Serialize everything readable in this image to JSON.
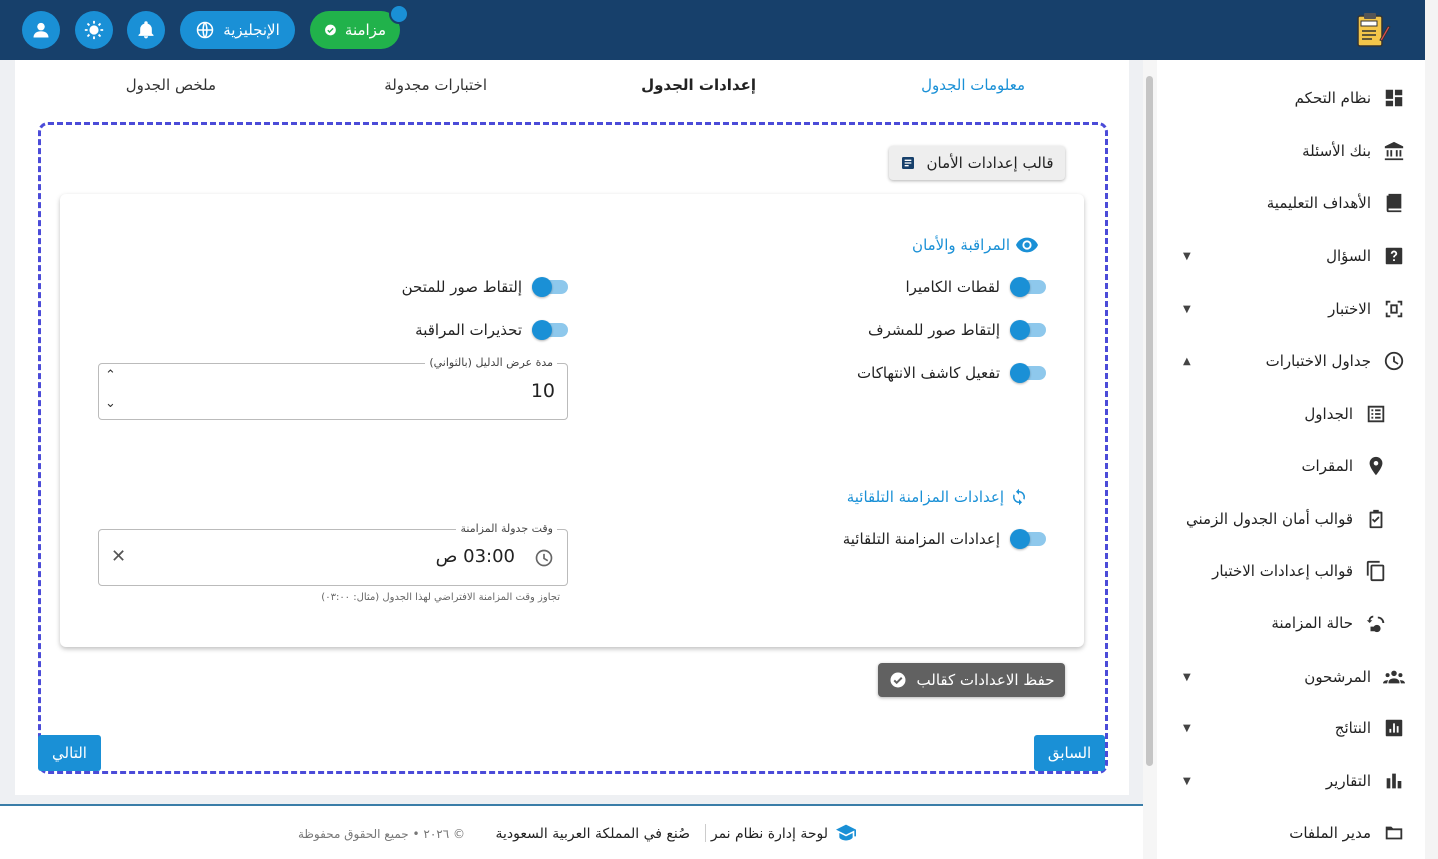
{
  "topbar": {
    "sync_label": "مزامنة",
    "language_label": "الإنجليزية"
  },
  "sidebar": {
    "items": [
      {
        "label": "نظام التحكم",
        "icon": "dashboard-icon"
      },
      {
        "label": "بنك الأسئلة",
        "icon": "bank-icon"
      },
      {
        "label": "الأهداف التعليمية",
        "icon": "book-question-icon"
      },
      {
        "label": "السؤال",
        "icon": "help-box-icon"
      },
      {
        "label": "الاختبار",
        "icon": "exam-frame-icon"
      },
      {
        "label": "جداول الاختبارات",
        "icon": "clock-icon"
      },
      {
        "label": "الجداول",
        "icon": "list-icon"
      },
      {
        "label": "المقرات",
        "icon": "location-pin-icon"
      },
      {
        "label": "قوالب أمان الجدول الزمني",
        "icon": "clipboard-check-icon"
      },
      {
        "label": "قوالب إعدادات الاختبار",
        "icon": "copy-icon"
      },
      {
        "label": "حالة المزامنة",
        "icon": "sync-status-icon"
      },
      {
        "label": "المرشحون",
        "icon": "people-icon"
      },
      {
        "label": "النتائج",
        "icon": "chart-box-icon"
      },
      {
        "label": "التقارير",
        "icon": "bar-chart-icon"
      },
      {
        "label": "مدير الملفات",
        "icon": "folder-icon"
      }
    ]
  },
  "tabs": {
    "info": "معلومات الجدول",
    "settings": "إعدادات الجدول",
    "scheduled": "اختبارات مجدولة",
    "summary": "ملخص الجدول"
  },
  "template_button": "قالب إعدادات الأمان",
  "monitoring": {
    "title": "المراقبة والأمان",
    "camera_snapshots": "لقطات الكاميرا",
    "proctor_photos": "إلتقاط صور للمشرف",
    "violation_detector": "تفعيل كاشف الانتهاكات",
    "examinee_photos": "إلتقاط صور للمتحن",
    "proctor_warnings": "تحذيرات المراقبة",
    "guide_duration_label": "مدة عرض الدليل (بالثواني)",
    "guide_duration_value": "10"
  },
  "autosync": {
    "title": "إعدادات المزامنة التلقائية",
    "toggle_label": "إعدادات المزامنة التلقائية",
    "time_label": "وقت جدولة المزامنة",
    "time_value": "03:00 ص",
    "helper": "تجاوز وقت المزامنة الافتراضي لهذا الجدول (مثال: ٠٣:٠٠)"
  },
  "save_template_button": "حفظ الاعدادات كقالب",
  "prev_button": "السابق",
  "next_button": "التالي",
  "footer": {
    "brand": "لوحة إدارة نظام نمر",
    "made_in": "صُنع في المملكة العربية السعودية",
    "copyright": "© ٢٠٢٦ • جميع الحقوق محفوظة"
  },
  "colors": {
    "topbar": "#17406b",
    "accent": "#1a90d6",
    "sync_green": "#21b24b",
    "dashed_border": "#4b4bd8"
  }
}
